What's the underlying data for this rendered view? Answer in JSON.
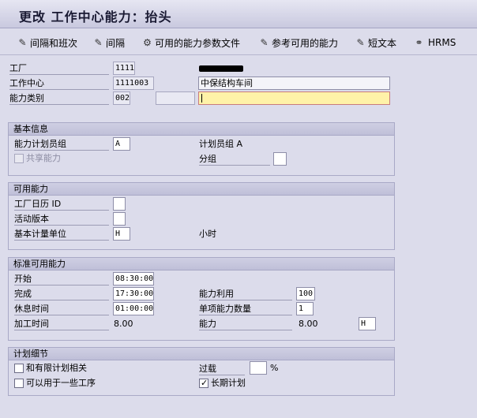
{
  "title": "更改 工作中心能力：抬头",
  "toolbar": {
    "items": [
      {
        "label": "间隔和班次",
        "icon": "pencil-icon"
      },
      {
        "label": "间隔",
        "icon": "pencil-icon"
      },
      {
        "label": "可用的能力参数文件",
        "icon": "parameter-icon"
      },
      {
        "label": "参考可用的能力",
        "icon": "pencil-icon"
      },
      {
        "label": "短文本",
        "icon": "pencil-icon"
      },
      {
        "label": "HRMS",
        "icon": "link-icon"
      }
    ]
  },
  "header": {
    "plant_label": "工厂",
    "plant_value": "1111",
    "work_center_label": "工作中心",
    "work_center_value": "1111003",
    "work_center_desc": "中保结构车间",
    "capacity_category_label": "能力类别",
    "capacity_category_value": "002",
    "capacity_category_extra": "",
    "capacity_desc": ""
  },
  "basic_info": {
    "title": "基本信息",
    "planner_group_label": "能力计划员组",
    "planner_group_value": "A",
    "planner_group_text": "计划员组 A",
    "shared_capacity_label": "共享能力",
    "grouping_label": "分组",
    "grouping_value": ""
  },
  "available_capacity": {
    "title": "可用能力",
    "factory_calendar_label": "工厂日历 ID",
    "factory_calendar_value": "",
    "active_version_label": "活动版本",
    "active_version_value": "",
    "base_unit_label": "基本计量单位",
    "base_unit_value": "H",
    "base_unit_text": "小时"
  },
  "standard_capacity": {
    "title": "标准可用能力",
    "start_label": "开始",
    "start_value": "08:30:00",
    "finish_label": "完成",
    "finish_value": "17:30:00",
    "break_label": "休息时间",
    "break_value": "01:00:00",
    "operating_time_label": "加工时间",
    "operating_time_value": "8.00",
    "utilization_label": "能力利用",
    "utilization_value": "100",
    "individual_cap_label": "单项能力数量",
    "individual_cap_value": "1",
    "capacity_label": "能力",
    "capacity_value": "8.00",
    "capacity_unit": "H"
  },
  "planning_details": {
    "title": "计划细节",
    "finite_planning_label": "和有限计划相关",
    "finite_planning_checked": false,
    "overload_label": "过载",
    "overload_value": "",
    "overload_unit": "%",
    "multiple_ops_label": "可以用于一些工序",
    "multiple_ops_checked": false,
    "long_term_label": "长期计划",
    "long_term_checked": true
  }
}
